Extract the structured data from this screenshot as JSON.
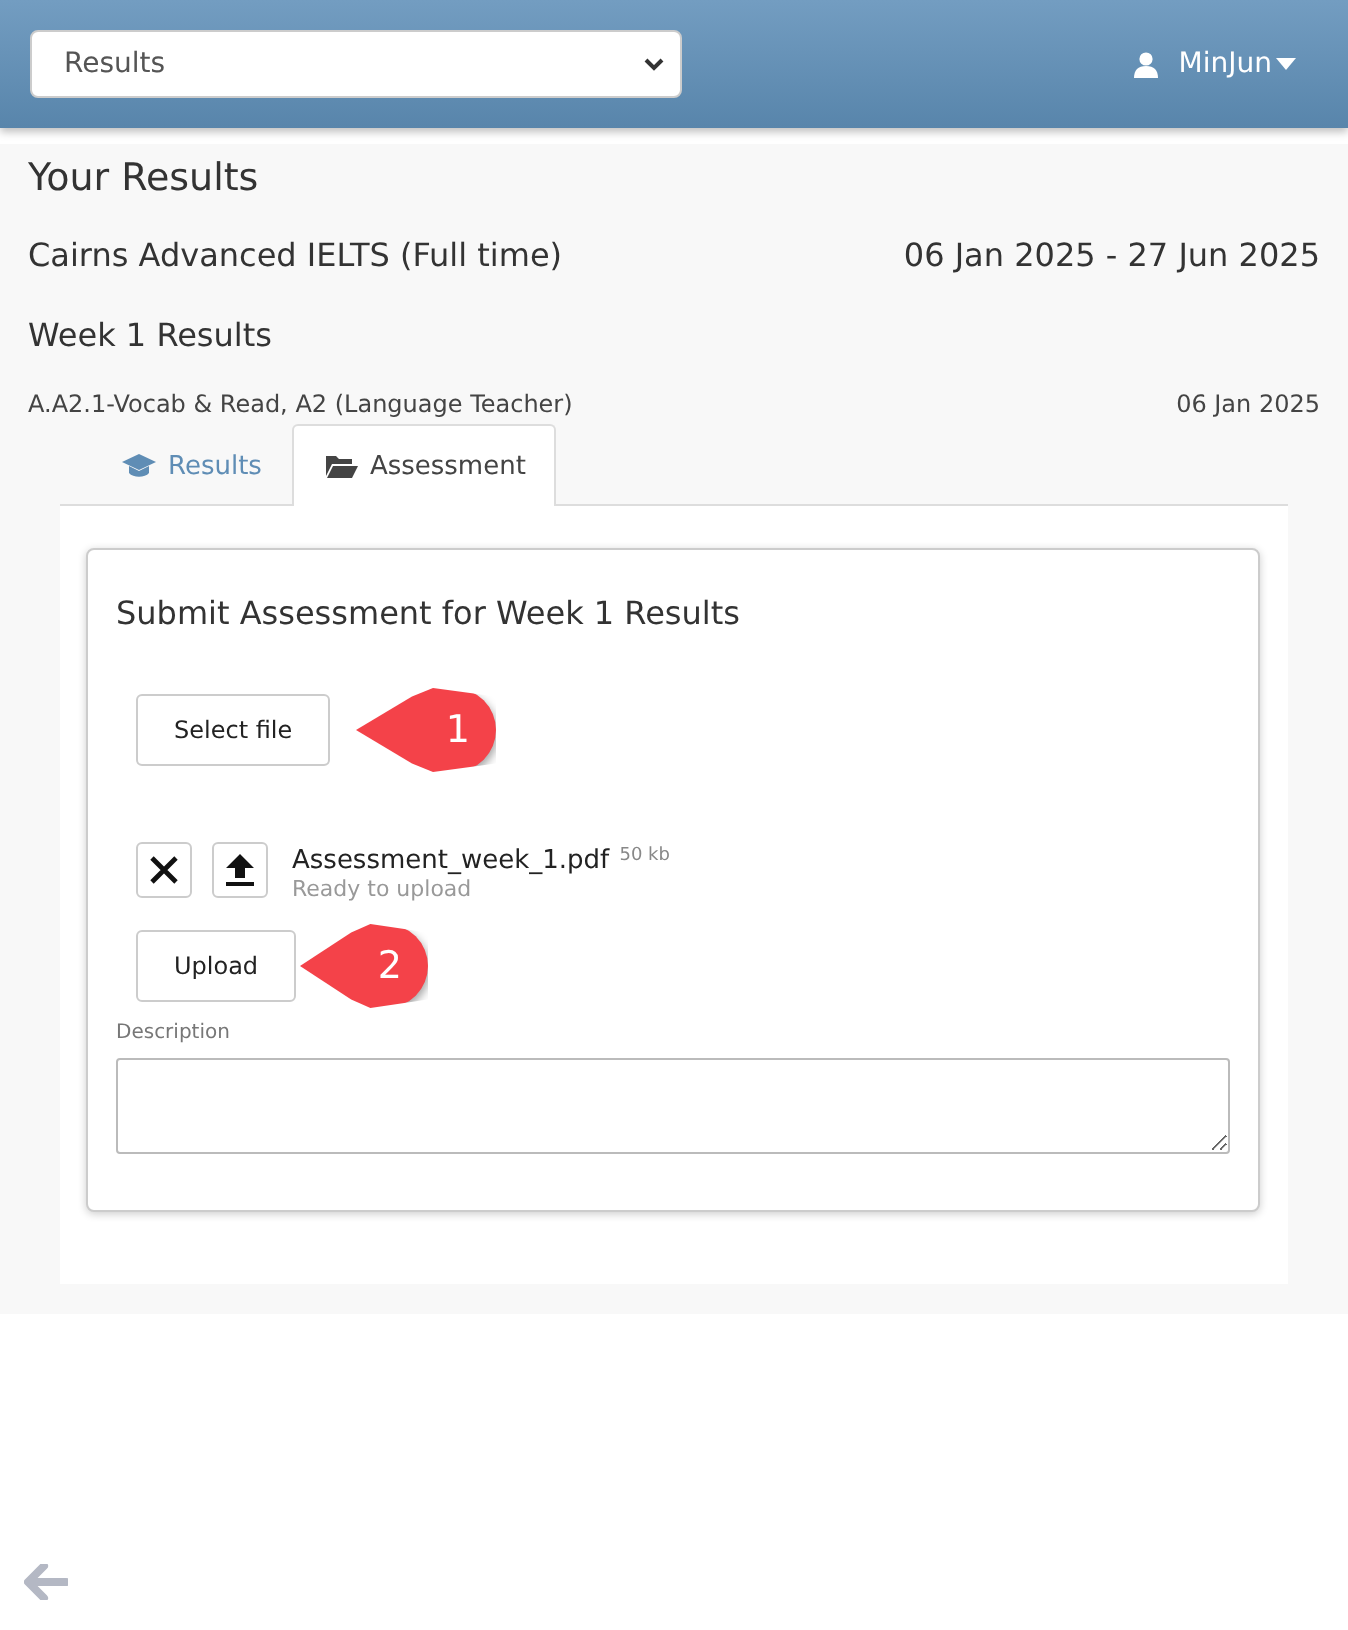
{
  "header": {
    "page_select": {
      "value": "Results"
    },
    "user_menu": {
      "label": "MinJun"
    }
  },
  "title": "Your Results",
  "course": {
    "name": "Cairns Advanced IELTS (Full time)",
    "dates": "06 Jan 2025 - 27 Jun 2025"
  },
  "week_title": "Week 1 Results",
  "unit": {
    "name": "A.A2.1-Vocab & Read, A2 (Language Teacher)",
    "date": "06 Jan 2025"
  },
  "tabs": [
    {
      "label": "Results",
      "selected": false
    },
    {
      "label": "Assessment",
      "selected": true
    }
  ],
  "assessment": {
    "heading": "Submit Assessment for Week 1 Results",
    "select_button": "Select file",
    "select_callout": "1",
    "file": {
      "name": "Assessment_week_1.pdf",
      "size": "50 kb",
      "status": "Ready to upload"
    },
    "upload_button": "Upload",
    "upload_callout": "2",
    "description_label": "Description"
  }
}
